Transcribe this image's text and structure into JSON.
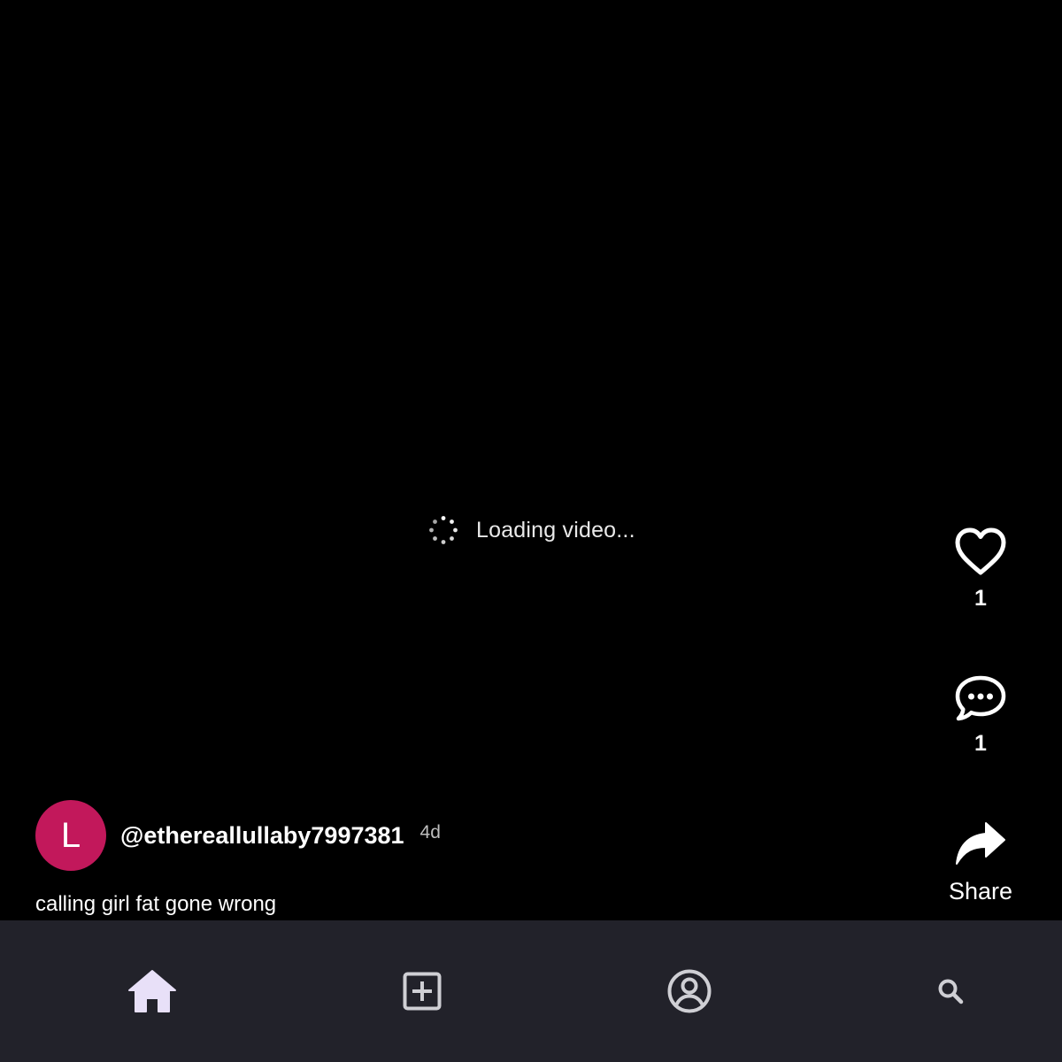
{
  "video": {
    "loading_text": "Loading video..."
  },
  "actions": {
    "like_count": "1",
    "comment_count": "1",
    "share_label": "Share"
  },
  "post": {
    "avatar_initial": "L",
    "avatar_color": "#c2185b",
    "username": "@ethereallullaby7997381",
    "time_ago": "4d",
    "caption": "calling girl fat gone wrong"
  },
  "nav": {
    "items": [
      {
        "icon": "home-icon",
        "active": true
      },
      {
        "icon": "create-icon",
        "active": false
      },
      {
        "icon": "profile-icon",
        "active": false
      },
      {
        "icon": "search-icon",
        "active": false
      }
    ],
    "active_color": "#e8e0f8",
    "inactive_color": "#cfcfd4",
    "background": "#22222a"
  }
}
